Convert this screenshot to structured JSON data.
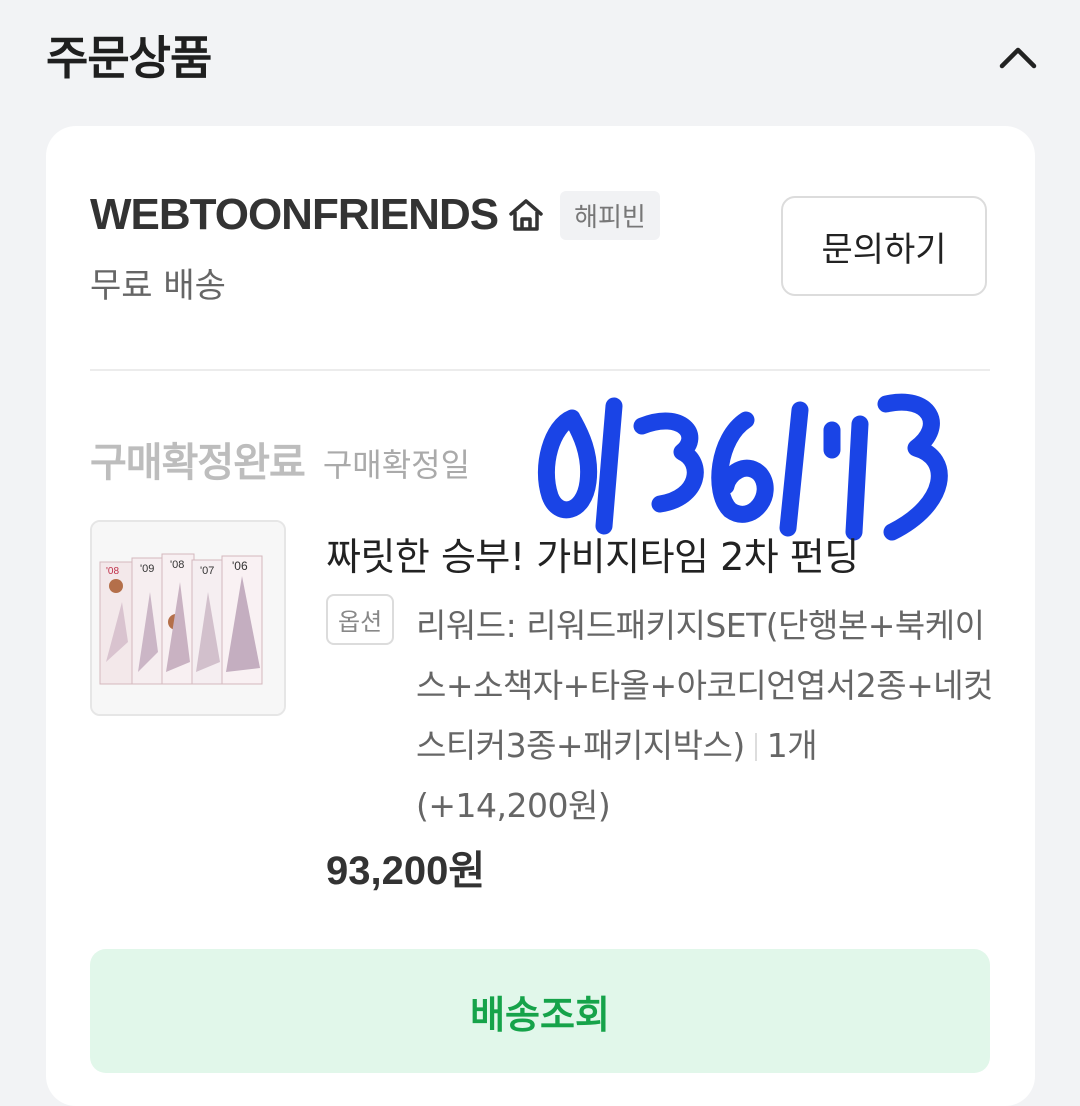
{
  "header": {
    "title": "주문상품",
    "collapse_icon": "chevron-up-icon"
  },
  "seller": {
    "name": "WEBTOONFRIENDS",
    "home_icon": "home-icon",
    "badge": "해피빈",
    "shipping": "무료 배송",
    "inquiry_label": "문의하기"
  },
  "order": {
    "status": "구매확정완료",
    "date_label": "구매확정일"
  },
  "product": {
    "title": "짜릿한 승부! 가비지타임 2차 펀딩",
    "option_badge": "옵션",
    "option_text": "리워드: 리워드패키지SET(단행본+북케이스+소책자+타올+아코디언엽서2종+네컷스티커3종+패키지박스)",
    "quantity": "1개",
    "option_price": "(+14,200원)",
    "price": "93,200원",
    "thumbnail_covers": [
      "'08",
      "'09",
      "'08",
      "'07",
      "'06"
    ]
  },
  "actions": {
    "track_label": "배송조회"
  },
  "colors": {
    "accent_green": "#16a34a",
    "track_bg": "#e1f7ea",
    "redaction_blue": "#1a44e6"
  }
}
